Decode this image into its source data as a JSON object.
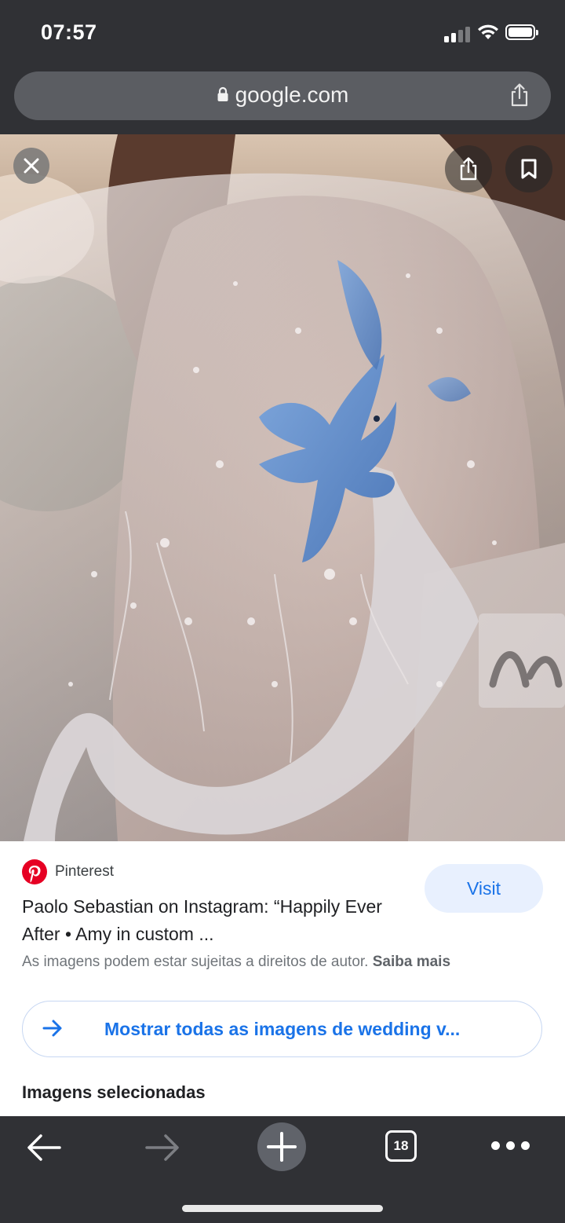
{
  "status_bar": {
    "time": "07:57"
  },
  "address_bar": {
    "url": "google.com"
  },
  "result": {
    "source": "Pinterest",
    "title": "Paolo Sebastian on Instagram: “Happily Ever After • Amy in custom ...",
    "visit_label": "Visit",
    "copyright_text": "As imagens podem estar sujeitas a direitos de autor.",
    "copyright_link": "Saiba mais",
    "show_all_label": "Mostrar todas as imagens de wedding v...",
    "section_title": "Imagens selecionadas"
  },
  "bottom_nav": {
    "tab_count": "18"
  },
  "colors": {
    "chrome_dark": "#303135",
    "link_blue": "#1a73e8",
    "pinterest_red": "#e60023",
    "visit_bg": "#e8f0fe"
  },
  "icons": [
    "lock-icon",
    "share-icon",
    "close-icon",
    "bookmark-icon",
    "pinterest-logo-icon",
    "arrow-right-icon",
    "back-arrow-icon",
    "forward-arrow-icon",
    "plus-icon",
    "tabs-icon",
    "more-icon"
  ]
}
